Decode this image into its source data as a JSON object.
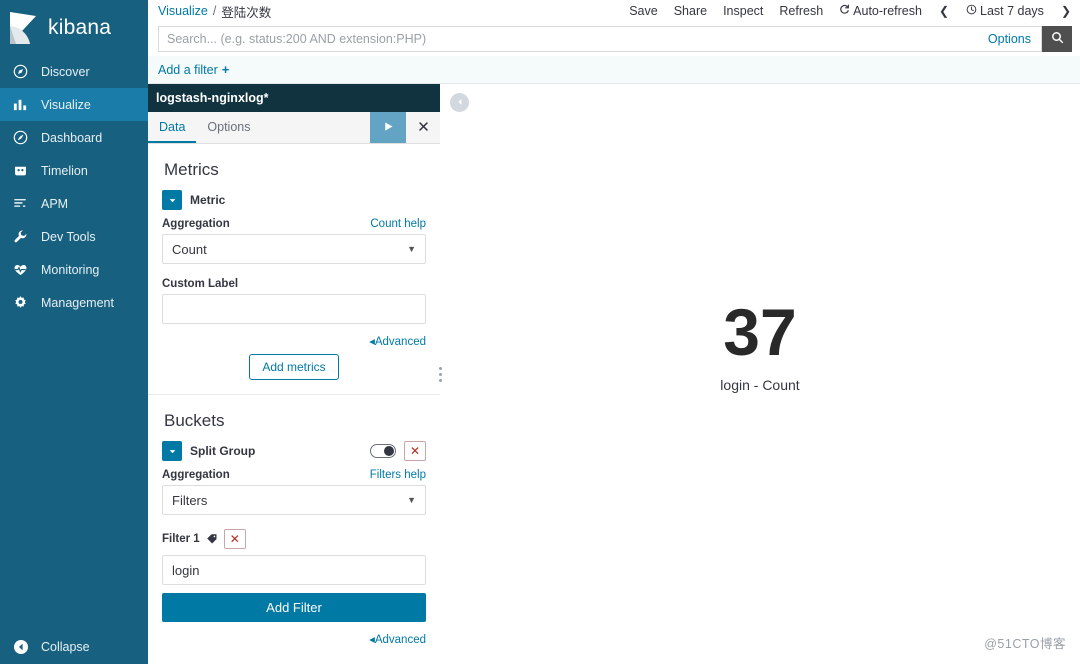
{
  "brand": {
    "name": "kibana",
    "logo_icon": "kibana-logo-icon"
  },
  "sidebar": {
    "items": [
      {
        "label": "Discover",
        "icon": "compass-icon",
        "active": false
      },
      {
        "label": "Visualize",
        "icon": "bar-chart-icon",
        "active": true
      },
      {
        "label": "Dashboard",
        "icon": "dashboard-icon",
        "active": false
      },
      {
        "label": "Timelion",
        "icon": "timelion-icon",
        "active": false
      },
      {
        "label": "APM",
        "icon": "apm-icon",
        "active": false
      },
      {
        "label": "Dev Tools",
        "icon": "wrench-icon",
        "active": false
      },
      {
        "label": "Monitoring",
        "icon": "heartbeat-icon",
        "active": false
      },
      {
        "label": "Management",
        "icon": "gear-icon",
        "active": false
      }
    ],
    "collapse_label": "Collapse",
    "collapse_icon": "collapse-left-icon",
    "bg_color": "#17607f",
    "active_color": "#1a7ca8"
  },
  "topbar": {
    "breadcrumb": {
      "root": "Visualize",
      "separator": "/",
      "current": "登陆次数"
    },
    "actions": [
      {
        "label": "Save",
        "icon": ""
      },
      {
        "label": "Share",
        "icon": ""
      },
      {
        "label": "Inspect",
        "icon": ""
      },
      {
        "label": "Refresh",
        "icon": ""
      }
    ],
    "auto_refresh": {
      "label": "Auto-refresh",
      "icon": "refresh-icon"
    },
    "time_picker": {
      "label": "Last 7 days",
      "icon": "clock-icon"
    },
    "prev_arrow": "❮",
    "next_arrow": "❯"
  },
  "query": {
    "placeholder": "Search... (e.g. status:200 AND extension:PHP)",
    "value": "",
    "options_label": "Options",
    "search_icon": "search-icon"
  },
  "filterbar": {
    "add_filter_label": "Add a filter",
    "plus": "+"
  },
  "editor": {
    "index_pattern": "logstash-nginxlog*",
    "tabs": [
      {
        "label": "Data",
        "active": true
      },
      {
        "label": "Options",
        "active": false
      }
    ],
    "apply_icon": "play-icon",
    "close_icon": "close-icon",
    "metrics": {
      "title": "Metrics",
      "agg_name": "Metric",
      "aggregation_label": "Aggregation",
      "help_label": "Count help",
      "aggregation_value": "Count",
      "custom_label_label": "Custom Label",
      "custom_label_value": "",
      "advanced_label": "Advanced",
      "add_metrics_label": "Add metrics"
    },
    "buckets": {
      "title": "Buckets",
      "agg_name": "Split Group",
      "aggregation_label": "Aggregation",
      "help_label": "Filters help",
      "aggregation_value": "Filters",
      "filter_label": "Filter 1",
      "filter_value": "login",
      "add_filter_label": "Add Filter",
      "advanced_label": "Advanced"
    }
  },
  "visualization": {
    "collapse_icon": "chevron-left-icon",
    "metric_value": "37",
    "metric_label": "login - Count"
  },
  "watermark": "@51CTO博客",
  "chart_data": {
    "type": "table",
    "title": "登陆次数",
    "categories": [
      "login"
    ],
    "values": [
      37
    ],
    "series": [
      {
        "name": "login - Count",
        "values": [
          37
        ]
      }
    ],
    "xlabel": "",
    "ylabel": "Count"
  }
}
